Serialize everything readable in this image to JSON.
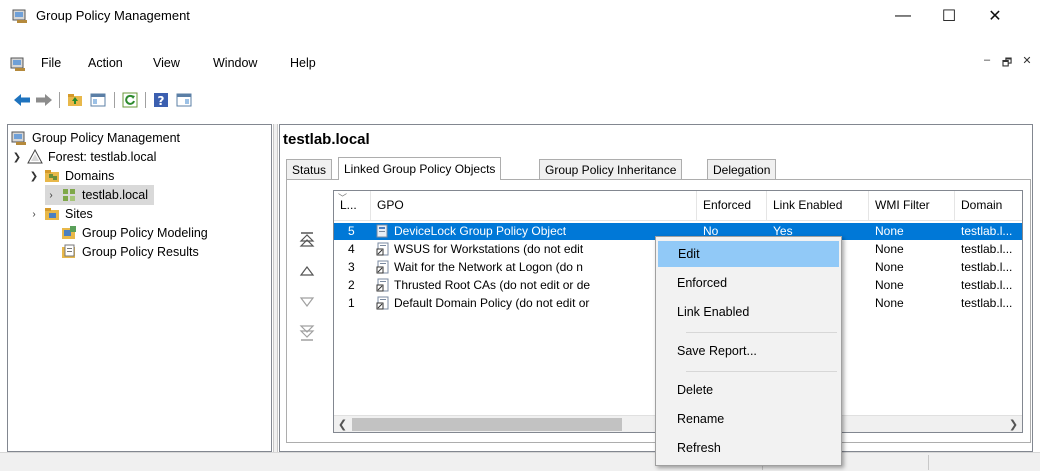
{
  "window": {
    "title": "Group Policy Management",
    "minimize_glyph": "—",
    "maximize_glyph": "☐",
    "close_glyph": "✕"
  },
  "menubar": {
    "items": [
      "File",
      "Action",
      "View",
      "Window",
      "Help"
    ],
    "mdi_glyphs": [
      "–",
      "🗗",
      "✕"
    ]
  },
  "tree": {
    "items": [
      {
        "label": "Group Policy Management",
        "icon": "gpm-icon"
      },
      {
        "label": "Forest: testlab.local",
        "icon": "forest-icon"
      },
      {
        "label": "Domains",
        "icon": "domains-folder-icon"
      },
      {
        "label": "testlab.local",
        "icon": "domain-icon"
      },
      {
        "label": "Sites",
        "icon": "sites-folder-icon"
      },
      {
        "label": "Group Policy Modeling",
        "icon": "modeling-icon"
      },
      {
        "label": "Group Policy Results",
        "icon": "results-icon"
      }
    ]
  },
  "main": {
    "heading": "testlab.local",
    "tabs": [
      "Status",
      "Linked Group Policy Objects",
      "Group Policy Inheritance",
      "Delegation"
    ],
    "active_tab": "Linked Group Policy Objects",
    "columns": [
      "L...",
      "GPO",
      "Enforced",
      "Link Enabled",
      "WMI Filter",
      "Domain"
    ],
    "rows": [
      {
        "order": "5",
        "gpo": "DeviceLock Group Policy Object",
        "enforced": "No",
        "link_enabled": "Yes",
        "wmi": "None",
        "domain": "testlab.l..."
      },
      {
        "order": "4",
        "gpo": "WSUS for Workstations (do not edit",
        "enforced": "",
        "link_enabled": "",
        "wmi": "None",
        "domain": "testlab.l..."
      },
      {
        "order": "3",
        "gpo": "Wait for the Network at Logon (do n",
        "enforced": "",
        "link_enabled": "",
        "wmi": "None",
        "domain": "testlab.l..."
      },
      {
        "order": "2",
        "gpo": "Thrusted Root CAs (do not edit or de",
        "enforced": "",
        "link_enabled": "",
        "wmi": "None",
        "domain": "testlab.l..."
      },
      {
        "order": "1",
        "gpo": "Default Domain Policy (do not edit or",
        "enforced": "",
        "link_enabled": "",
        "wmi": "None",
        "domain": "testlab.l..."
      }
    ]
  },
  "context_menu": {
    "items": [
      "Edit",
      "Enforced",
      "Link Enabled",
      "Save Report...",
      "Delete",
      "Rename",
      "Refresh"
    ]
  },
  "colors": {
    "selection": "#0078d7",
    "menu_highlight": "#91c9f7"
  }
}
